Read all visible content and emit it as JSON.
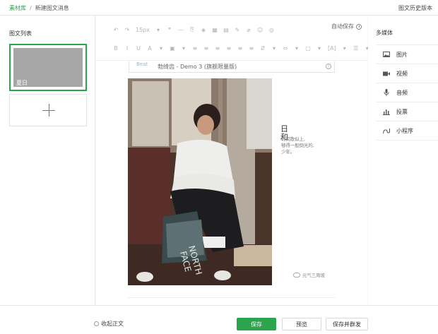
{
  "topbar": {
    "breadcrumb_root": "素材库",
    "breadcrumb_separator": "/",
    "breadcrumb_current": "新建图文消息",
    "history_label": "图文历史版本"
  },
  "left_panel": {
    "title": "图文列表",
    "articles": [
      {
        "thumb_label": "夏日"
      }
    ]
  },
  "editor": {
    "toolbar_row1": [
      "↶",
      "↷",
      "15px",
      "▾",
      "❞",
      "—",
      "⎘",
      "◈",
      "▦",
      "▤",
      "✎",
      "⌀",
      "☺",
      "◎"
    ],
    "toolbar_row2": [
      "B",
      "I",
      "U",
      "A",
      "▾",
      "▣",
      "▾",
      "≡",
      "≡",
      "≡",
      "≡",
      "≡",
      "≡",
      "⇵",
      "▾",
      "⇔",
      "▾",
      "▢",
      "▾",
      "[A]",
      "▾",
      "☰",
      "▾",
      "☷",
      "▾"
    ],
    "autosave_label": "自动保存",
    "source_name": "勃绮齿 - Demo 3 (旗舰限量版)",
    "source_logo_text": "Beat"
  },
  "article": {
    "side_title": "日和",
    "side_poem": "时间散似上,\n够得一般倒光的,\n少年。",
    "watermark": "元气三周坡"
  },
  "right_panel": {
    "title": "多媒体",
    "items": [
      {
        "label": "图片",
        "icon": "image-icon"
      },
      {
        "label": "视频",
        "icon": "video-icon"
      },
      {
        "label": "音频",
        "icon": "microphone-icon"
      },
      {
        "label": "投票",
        "icon": "bar-chart-icon"
      },
      {
        "label": "小程序",
        "icon": "mini-program-icon"
      }
    ]
  },
  "footer": {
    "collapse_label": "收起正文",
    "save_label": "保存",
    "preview_label": "预览",
    "publish_label": "保存并群发"
  },
  "colors": {
    "accent": "#2aa54e",
    "thumb_gray": "#a7a7a7"
  }
}
